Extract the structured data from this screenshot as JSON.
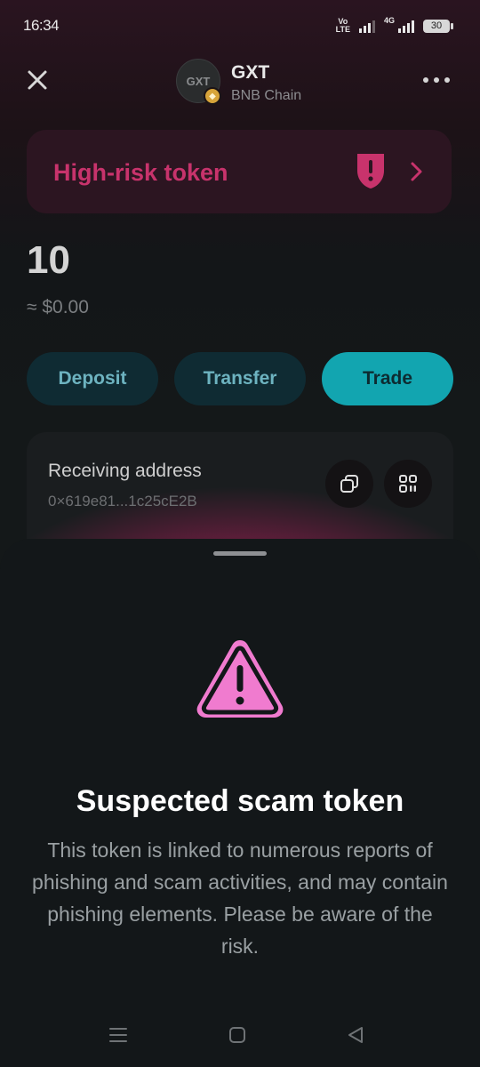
{
  "status_bar": {
    "time": "16:34",
    "volte_top": "Vo",
    "volte_bottom": "LTE",
    "network": "4G",
    "battery": "30"
  },
  "header": {
    "token_logo_text": "GXT",
    "token_name": "GXT",
    "chain_name": "BNB Chain"
  },
  "risk_banner": {
    "label": "High-risk token",
    "color": "#c8336c"
  },
  "balance": {
    "amount": "10",
    "fiat": "≈ $0.00"
  },
  "actions": {
    "deposit": "Deposit",
    "transfer": "Transfer",
    "trade": "Trade"
  },
  "address_card": {
    "label": "Receiving address",
    "address": "0×619e81...1c25cE2B"
  },
  "sheet": {
    "title": "Suspected scam token",
    "body": "This token is linked to numerous reports of phishing and scam activities, and may contain phishing elements. Please be aware of the risk.",
    "warning_color": "#f07bcf"
  },
  "colors": {
    "accent_teal": "#12a5b0",
    "danger_pink": "#c8336c",
    "background": "#141819"
  }
}
